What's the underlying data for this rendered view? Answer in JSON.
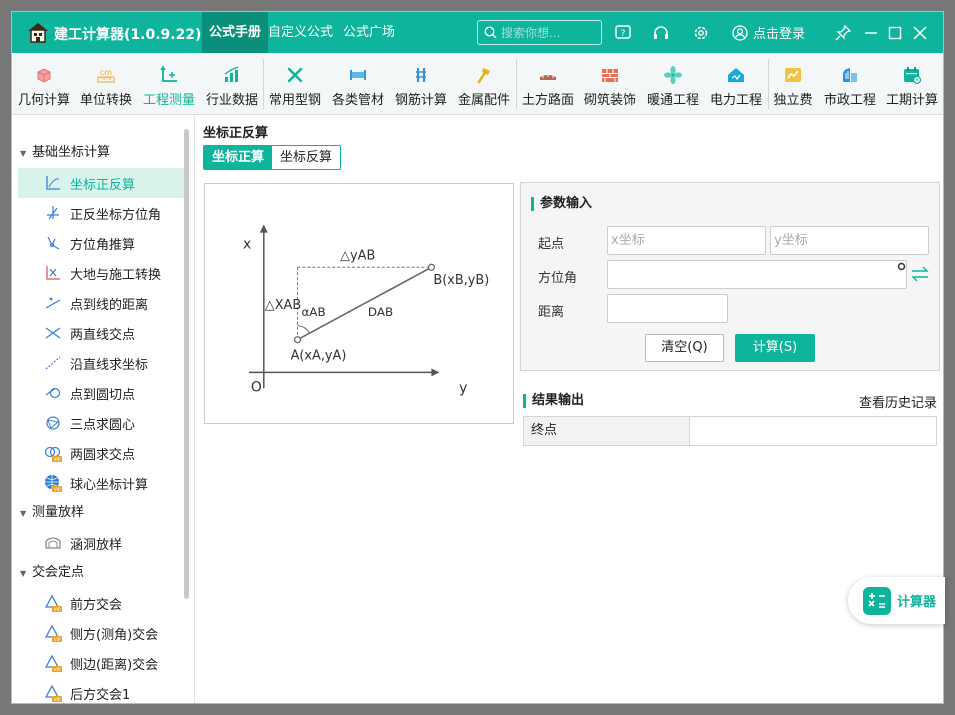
{
  "app": {
    "title": "建工计算器(1.0.9.22)",
    "tabs": [
      "公式手册",
      "自定义公式",
      "公式广场"
    ],
    "search_placeholder": "搜索你想...",
    "login_label": "点击登录",
    "accent": "#0fb49c"
  },
  "toolbar": {
    "items": [
      {
        "label": "几何计算",
        "icon": "cube-icon"
      },
      {
        "label": "单位转换",
        "icon": "ruler-cm-icon"
      },
      {
        "label": "工程测量",
        "icon": "axes-icon"
      },
      {
        "label": "行业数据",
        "icon": "bar-chart-icon"
      },
      {
        "label": "常用型钢",
        "icon": "wrench-icon"
      },
      {
        "label": "各类管材",
        "icon": "pipe-icon"
      },
      {
        "label": "钢筋计算",
        "icon": "rebar-icon"
      },
      {
        "label": "金属配件",
        "icon": "hammer-icon"
      },
      {
        "label": "土方路面",
        "icon": "road-icon"
      },
      {
        "label": "砌筑装饰",
        "icon": "brick-icon"
      },
      {
        "label": "暖通工程",
        "icon": "fan-icon"
      },
      {
        "label": "电力工程",
        "icon": "power-house-icon"
      },
      {
        "label": "独立费",
        "icon": "coin-chart-icon"
      },
      {
        "label": "市政工程",
        "icon": "municipal-icon"
      },
      {
        "label": "工期计算",
        "icon": "calendar-icon"
      }
    ],
    "active_index": 2
  },
  "sidebar": {
    "groups": [
      {
        "label": "基础坐标计算",
        "items": [
          {
            "label": "坐标正反算",
            "icon": "coordinate-icon",
            "active": true
          },
          {
            "label": "正反坐标方位角",
            "icon": "azimuth-icon"
          },
          {
            "label": "方位角推算",
            "icon": "azimuth-calc-icon"
          },
          {
            "label": "大地与施工转换",
            "icon": "transform-icon"
          },
          {
            "label": "点到线的距离",
            "icon": "point-line-icon"
          },
          {
            "label": "两直线交点",
            "icon": "intersection-icon"
          },
          {
            "label": "沿直线求坐标",
            "icon": "line-coord-icon"
          },
          {
            "label": "点到圆切点",
            "icon": "tangent-icon"
          },
          {
            "label": "三点求圆心",
            "icon": "circle-center-icon"
          },
          {
            "label": "两圆求交点",
            "icon": "circles-vip-icon"
          },
          {
            "label": "球心坐标计算",
            "icon": "globe-vip-icon"
          }
        ]
      },
      {
        "label": "测量放样",
        "items": [
          {
            "label": "涵洞放样",
            "icon": "culvert-icon"
          }
        ]
      },
      {
        "label": "交会定点",
        "items": [
          {
            "label": "前方交会",
            "icon": "triangle-vip-icon"
          },
          {
            "label": "侧方(测角)交会",
            "icon": "triangle-vip-icon"
          },
          {
            "label": "侧边(距离)交会",
            "icon": "triangle-vip-icon"
          },
          {
            "label": "后方交会1",
            "icon": "triangle-vip-icon"
          }
        ]
      }
    ]
  },
  "main": {
    "title": "坐标正反算",
    "tabs": [
      "坐标正算",
      "坐标反算"
    ],
    "diagram": {
      "x_axis": "x",
      "y_axis": "y",
      "origin": "O",
      "dy": "△yAB",
      "dx": "△XAB",
      "alpha": "αAB",
      "dist": "DAB",
      "pointA": "A(xA,yA)",
      "pointB": "B(xB,yB)"
    },
    "params": {
      "title": "参数输入",
      "start_label": "起点",
      "x_placeholder": "x坐标",
      "y_placeholder": "y坐标",
      "azimuth_label": "方位角",
      "distance_label": "距离",
      "clear_button": "清空(Q)",
      "calc_button": "计算(S)"
    },
    "result": {
      "title": "结果输出",
      "history_link": "查看历史记录",
      "rows": [
        {
          "key": "终点",
          "value": ""
        }
      ]
    }
  },
  "fab": {
    "label": "计算器"
  }
}
